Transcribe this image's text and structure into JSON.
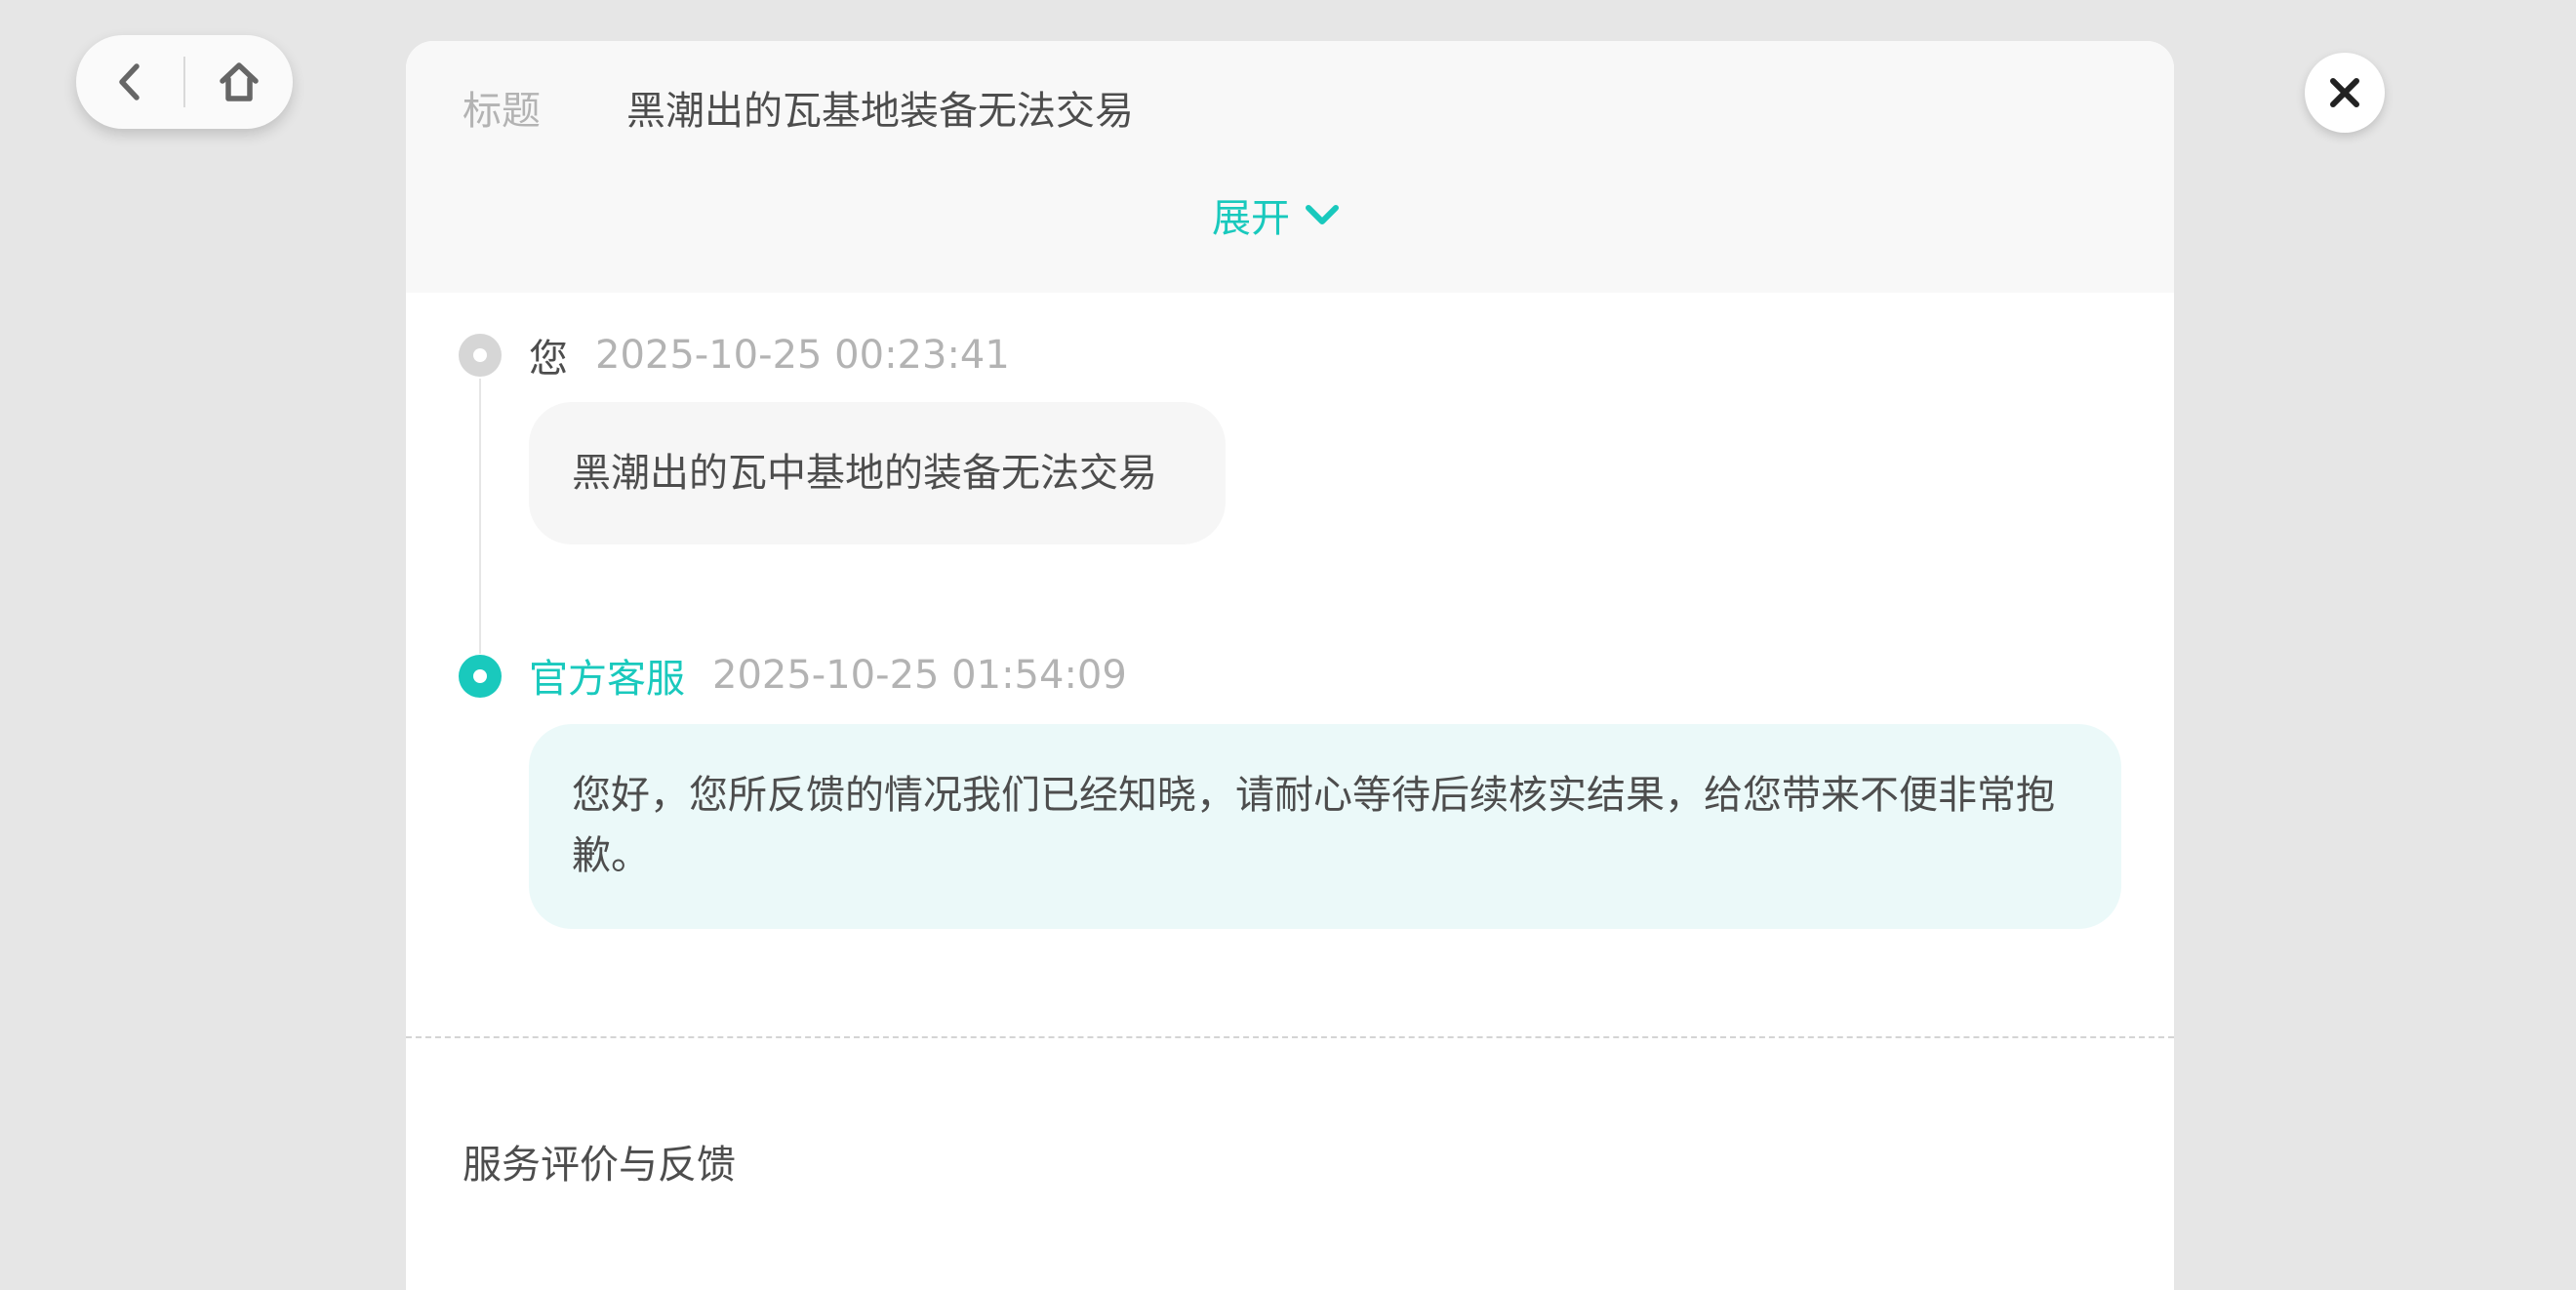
{
  "nav": {
    "back_icon": "chevron-left-icon",
    "home_icon": "home-icon"
  },
  "close_icon": "close-icon",
  "ticket": {
    "title_label": "标题",
    "title": "黑潮出的瓦基地装备无法交易",
    "expand_label": "展开",
    "expand_icon": "chevron-down-icon"
  },
  "messages": [
    {
      "sender": "您",
      "time": "2025-10-25 00:23:41",
      "text": "黑潮出的瓦中基地的装备无法交易"
    },
    {
      "sender": "官方客服",
      "time": "2025-10-25 01:54:09",
      "text": "您好，您所反馈的情况我们已经知晓，请耐心等待后续核实结果，给您带来不便非常抱歉。"
    }
  ],
  "feedback": {
    "section_title": "服务评价与反馈"
  },
  "colors": {
    "accent": "#19c9bd",
    "background": "#e6e6e6",
    "agent_bubble": "#ebf9f9",
    "user_bubble": "#f6f6f6"
  }
}
